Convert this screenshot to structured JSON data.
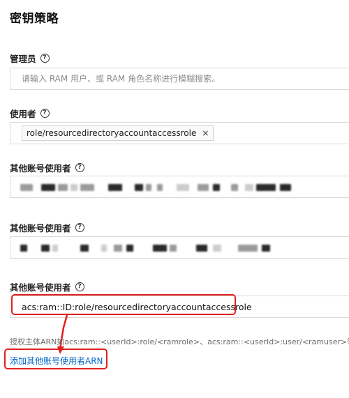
{
  "page": {
    "title": "密钥策略"
  },
  "admin": {
    "label": "管理员",
    "help_glyph": "?",
    "search_placeholder": "请输入 RAM 用户、或 RAM 角色名称进行模糊搜索。"
  },
  "users": {
    "label": "使用者",
    "help_glyph": "?",
    "tags": [
      {
        "text": "role/resourcedirectoryaccountaccessrole",
        "close": "×"
      }
    ]
  },
  "other_accounts": [
    {
      "label": "其他账号使用者",
      "help_glyph": "?"
    },
    {
      "label": "其他账号使用者",
      "help_glyph": "?"
    },
    {
      "label": "其他账号使用者",
      "help_glyph": "?",
      "value": "acs:ram::ID:role/resourcedirectoryaccountaccessrole"
    }
  ],
  "hint": "授权主体ARN如acs:ram::<userId>:role/<ramrole>、acs:ram::<userId>:user/<ramuser>等",
  "add_link": "添加其他账号使用者ARN",
  "colors": {
    "link": "#0066cc",
    "highlight": "#e02020",
    "border": "#d9d9d9"
  }
}
